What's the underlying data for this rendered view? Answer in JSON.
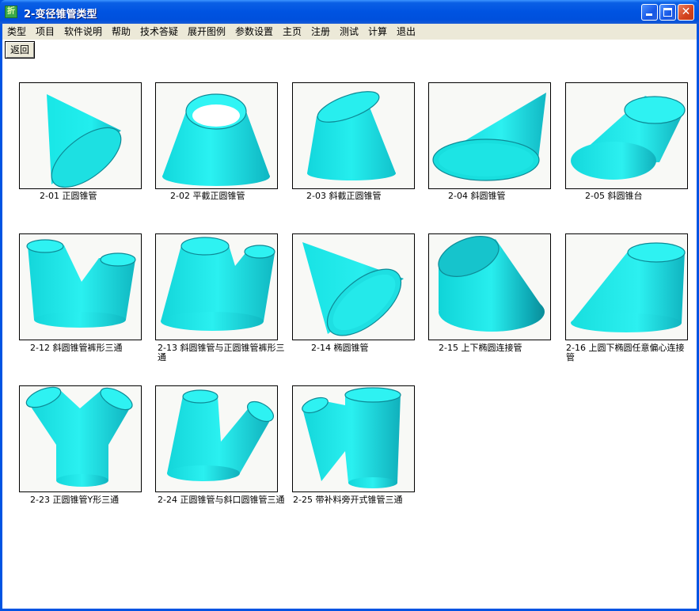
{
  "window": {
    "title": "2-变径锥管类型",
    "icon_glyph": "折"
  },
  "menu": {
    "items": [
      "类型",
      "项目",
      "软件说明",
      "帮助",
      "技术答疑",
      "展开图例",
      "参数设置",
      "主页",
      "注册",
      "测试",
      "计算",
      "退出"
    ]
  },
  "toolbar": {
    "back_label": "返回"
  },
  "colors": {
    "shape_fill": "#18e6e6",
    "shape_dark": "#0aa6b4",
    "shape_rim": "#0e8a96",
    "title_bar": "#0053e1"
  },
  "types": [
    {
      "caption": "2-01 正圆锥管",
      "icon": "right-circular-cone"
    },
    {
      "caption": "2-02 平截正圆锥管",
      "icon": "truncated-cone"
    },
    {
      "caption": "2-03 斜截正圆锥管",
      "icon": "oblique-cut-cone"
    },
    {
      "caption": "2-04 斜圆锥管",
      "icon": "oblique-cone"
    },
    {
      "caption": "2-05 斜圆锥台",
      "icon": "oblique-frustum"
    },
    {
      "caption": "2-12 斜圆锥管裤形三通",
      "icon": "oblique-pants-tee"
    },
    {
      "caption": "2-13 斜圆锥管与正圆锥管裤形三通",
      "icon": "mixed-pants-tee"
    },
    {
      "caption": "2-14 椭圆锥管",
      "icon": "elliptic-cone"
    },
    {
      "caption": "2-15 上下椭圆连接管",
      "icon": "ellipse-transition"
    },
    {
      "caption": "2-16 上圆下椭圆任意偏心连接管",
      "icon": "eccentric-transition"
    },
    {
      "caption": "2-23 正圆锥管Y形三通",
      "icon": "y-tee"
    },
    {
      "caption": "2-24 正圆锥管与斜口圆锥管三通",
      "icon": "branch-tee"
    },
    {
      "caption": "2-25 带补料旁开式锥管三通",
      "icon": "side-tee"
    }
  ]
}
